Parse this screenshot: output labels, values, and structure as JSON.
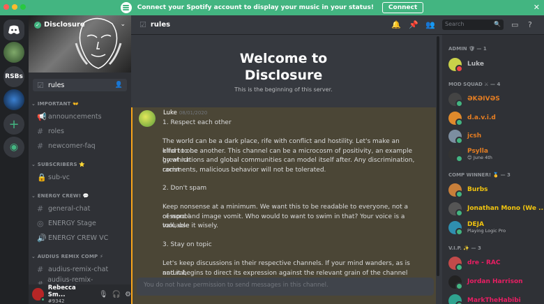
{
  "banner": {
    "text": "Connect your Spotify account to display your music in your status!",
    "connect_label": "Connect",
    "close_label": "✕"
  },
  "guilds": {
    "rsbs_label": "RSBs"
  },
  "server": {
    "name": "Disclosure"
  },
  "channels": {
    "active": "rules",
    "categories": [
      {
        "label": "IMPORTANT",
        "emoji": "👐",
        "items": [
          "announcements",
          "roles",
          "newcomer-faq"
        ]
      },
      {
        "label": "SUBSCRIBERS",
        "emoji": "⭐",
        "items": [
          "sub-vc"
        ]
      },
      {
        "label": "ENERGY CREW!",
        "emoji": "💬",
        "items": [
          "general-chat",
          "ENERGY Stage",
          "ENERGY CREW VC"
        ]
      },
      {
        "label": "AUDIUS REMIX COMP",
        "emoji": "⚡",
        "items": [
          "audius-remix-chat",
          "audius-remix-submissions"
        ]
      }
    ]
  },
  "user": {
    "name": "Rebecca Sm...",
    "tag": "#9342"
  },
  "header": {
    "channel": "rules",
    "search_placeholder": "Search"
  },
  "welcome": {
    "line1": "Welcome to",
    "line2": "Disclosure",
    "subtitle": "This is the beginning of this server."
  },
  "message": {
    "author": "Luke",
    "date": "08/01/2020",
    "lines": [
      "1. Respect each other",
      "",
      "The world can be a dark place, rife with conflict and hostility. Let's make an effort to be",
      "kind to one another. This channel can be a microcosm of positivity, an example by which",
      "great nations and global communities can model itself after. Any discrimination, racist",
      "comments, malicious behavior will not be tolerated.",
      "",
      "2. Don't spam",
      "",
      "Keep nonsense at a minimum. We want this to be readable to everyone, not a cesspool",
      "of word and image vomit. Who would to want to swim in that? Your voice is a valuable",
      "tool, use it wisely.",
      "",
      "3. Stay on topic",
      "",
      "Let's keep discussions in their respective channels. If your mind wanders, as is natural,",
      "and it begins to direct its expression against the relevant grain of the channel you're in,"
    ]
  },
  "composer": {
    "placeholder": "You do not have permission to send messages in this channel."
  },
  "members": {
    "groups": [
      {
        "label": "ADMIN 🛡 — 1",
        "members": [
          {
            "name": "Luke",
            "color": "#b9bbbe",
            "status": "",
            "avatar": "#c9d14a",
            "presence": "#f04747"
          }
        ]
      },
      {
        "label": "MOD SQUAD ⚔ — 4",
        "members": [
          {
            "name": "ƏKƏIVƏS",
            "color": "#e67e22",
            "status": "",
            "avatar": "#444",
            "presence": "#43b581"
          },
          {
            "name": "d.a.v.i.d",
            "color": "#e67e22",
            "status": "",
            "avatar": "#e08a2c",
            "presence": "#43b581"
          },
          {
            "name": "jcsh",
            "color": "#e67e22",
            "status": "",
            "avatar": "#7c8ea0",
            "presence": "#43b581"
          },
          {
            "name": "Psylla",
            "color": "#e67e22",
            "status": "😊 June 4th",
            "avatar": "#333",
            "presence": "#43b581"
          }
        ]
      },
      {
        "label": "COMP WINNER! 🥇 — 3",
        "members": [
          {
            "name": "Burbs",
            "color": "#f1c40f",
            "status": "",
            "avatar": "#c87f3a",
            "presence": "#43b581"
          },
          {
            "name": "Jonathan Mono (We ...",
            "color": "#f1c40f",
            "status": "",
            "avatar": "#555",
            "presence": "#43b581"
          },
          {
            "name": "DEJA",
            "color": "#f1c40f",
            "status": "Playing Logic Pro",
            "avatar": "#2f8fb0",
            "presence": "#43b581"
          }
        ]
      },
      {
        "label": "V.I.P. ✨ — 3",
        "members": [
          {
            "name": "dre - RAC",
            "color": "#e91e63",
            "status": "",
            "avatar": "#c34a4a",
            "presence": "#43b581"
          },
          {
            "name": "Jordan Harrison",
            "color": "#e91e63",
            "status": "",
            "avatar": "#222",
            "presence": "#43b581"
          },
          {
            "name": "MarkTheHabibi",
            "color": "#e91e63",
            "status": "",
            "avatar": "#2fa38f",
            "presence": "#43b581"
          }
        ]
      }
    ]
  }
}
